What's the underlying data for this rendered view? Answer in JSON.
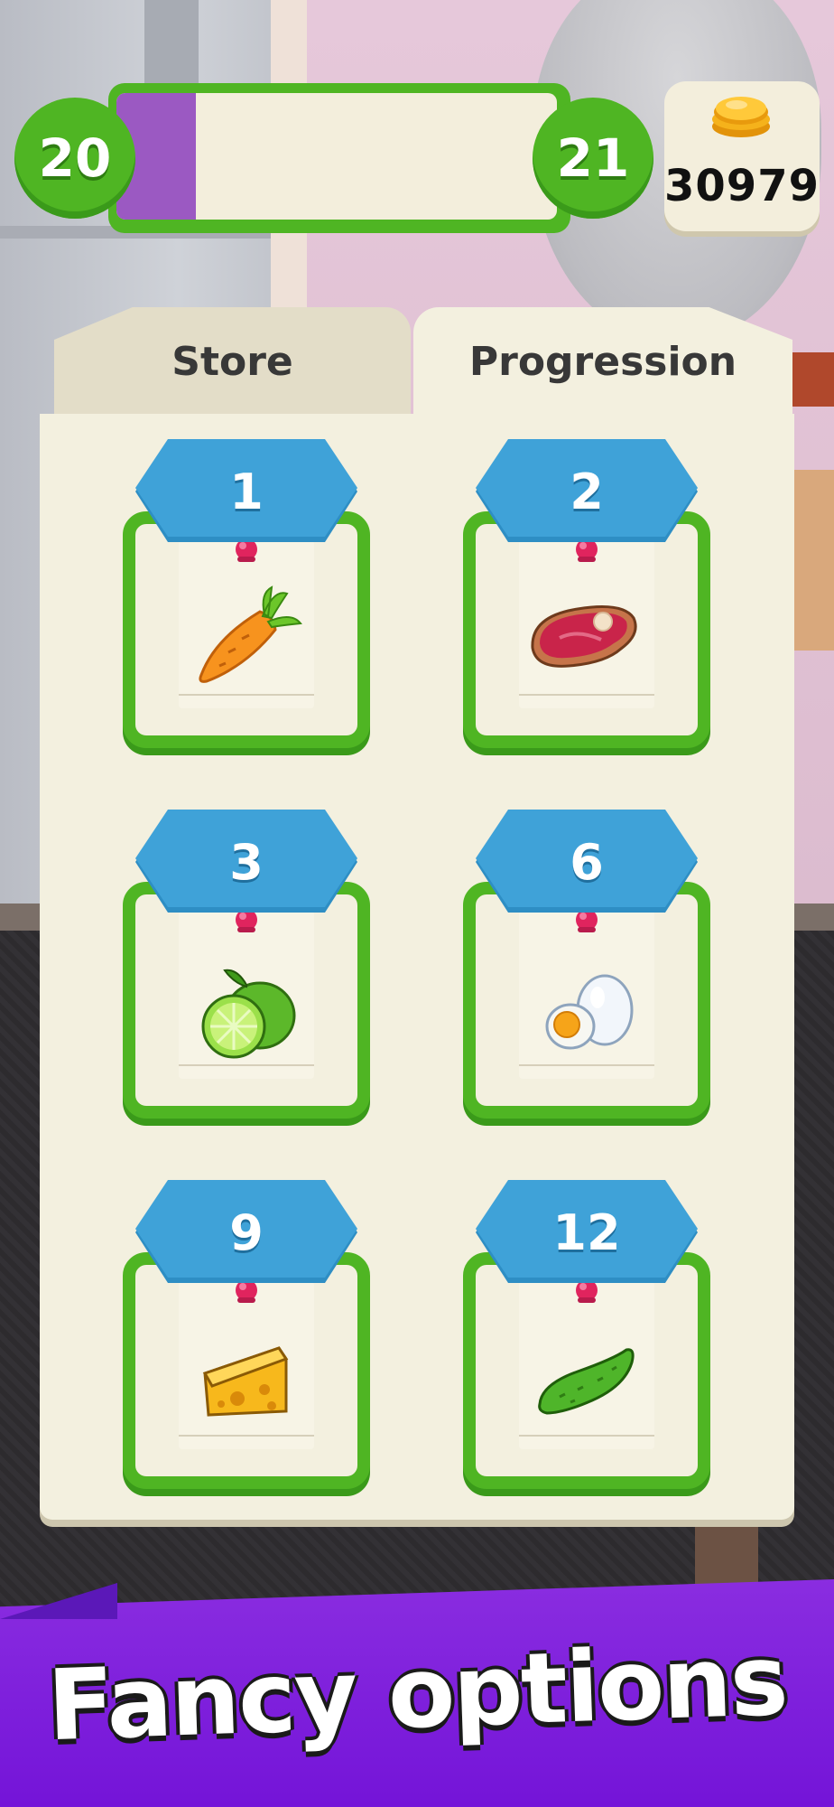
{
  "hud": {
    "current_level": "20",
    "next_level": "21",
    "xp_progress_fraction": 0.18,
    "coins": "30979"
  },
  "tabs": [
    {
      "label": "Store",
      "active": false
    },
    {
      "label": "Progression",
      "active": true
    }
  ],
  "unlocks": [
    {
      "level": "1",
      "item_icon": "carrot-icon"
    },
    {
      "level": "2",
      "item_icon": "steak-icon"
    },
    {
      "level": "3",
      "item_icon": "lime-icon"
    },
    {
      "level": "6",
      "item_icon": "boiled-egg-icon"
    },
    {
      "level": "9",
      "item_icon": "cheese-icon"
    },
    {
      "level": "12",
      "item_icon": "pickle-icon"
    }
  ],
  "banner": {
    "text": "Fancy options"
  },
  "colors": {
    "green": "#4fb523",
    "purple": "#9b59c2",
    "blue_badge": "#3fa2d8",
    "banner_purple": "#7d1fdc",
    "panel_cream": "#f3f0df"
  }
}
